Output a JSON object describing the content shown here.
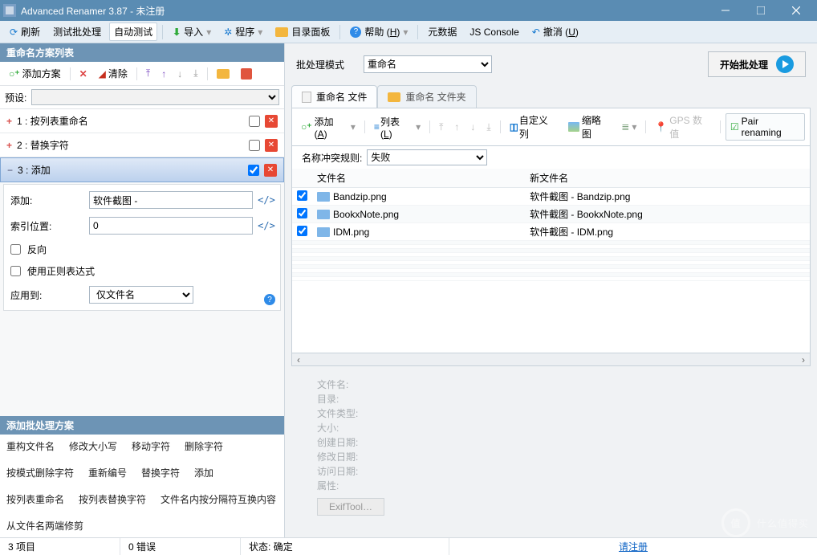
{
  "title": "Advanced Renamer 3.87 - 未注册",
  "menu": {
    "refresh": "刷新",
    "test_batch": "测试批处理",
    "auto_test": "自动测试",
    "import": "导入",
    "program": "程序",
    "folder_panel": "目录面板",
    "help": "帮助 (",
    "help_u": "H",
    "help_suffix": ")",
    "metadata": "元数据",
    "js_console": "JS Console",
    "undo": "撤消 (",
    "undo_u": "U",
    "undo_suffix": ")"
  },
  "left": {
    "header": "重命名方案列表",
    "add_method": "添加方案",
    "clear": "清除",
    "preset_label": "预设:",
    "methods": [
      {
        "idx": "1",
        "name": "按列表重命名",
        "checked": false
      },
      {
        "idx": "2",
        "name": "替换字符",
        "checked": false
      },
      {
        "idx": "3",
        "name": "添加",
        "checked": true
      }
    ],
    "add_form": {
      "add_label": "添加:",
      "add_value": "软件截图 - ",
      "index_label": "索引位置:",
      "index_value": "0",
      "backwards": "反向",
      "regex": "使用正则表达式",
      "apply_label": "应用到:",
      "apply_value": "仅文件名"
    },
    "add_scheme_header": "添加批处理方案",
    "schemes": [
      "重构文件名",
      "修改大小写",
      "移动字符",
      "删除字符",
      "按模式删除字符",
      "重新编号",
      "替换字符",
      "添加",
      "按列表重命名",
      "按列表替换字符",
      "文件名内按分隔符互换内容",
      "从文件名两端修剪"
    ]
  },
  "right": {
    "batch_mode_label": "批处理模式",
    "batch_mode_value": "重命名",
    "start_batch": "开始批处理",
    "tabs": {
      "files": "重命名 文件",
      "folders": "重命名 文件夹"
    },
    "file_tb": {
      "add": "添加 (",
      "add_u": "A",
      "list": "列表 (",
      "list_u": "L",
      "suffix": ")",
      "custom_cols": "自定义列",
      "thumbs": "缩略图",
      "gps": "GPS 数值",
      "pair": "Pair renaming"
    },
    "rule_label": "名称冲突规则:",
    "rule_value": "失败",
    "columns": {
      "c1": "文件名",
      "c2": "新文件名"
    },
    "rows": [
      {
        "name": "Bandzip.png",
        "newname": "软件截图 - Bandzip.png"
      },
      {
        "name": "BookxNote.png",
        "newname": "软件截图 - BookxNote.png"
      },
      {
        "name": "IDM.png",
        "newname": "软件截图 - IDM.png"
      }
    ],
    "details": {
      "filename": "文件名:",
      "dir": "目录:",
      "type": "文件类型:",
      "size": "大小:",
      "created": "创建日期:",
      "modified": "修改日期:",
      "accessed": "访问日期:",
      "attrs": "属性:",
      "exif": "ExifTool…"
    }
  },
  "status": {
    "items": "3 项目",
    "errors": "0 错误",
    "state_label": "状态:",
    "state_value": "确定",
    "register": "请注册"
  },
  "watermark": {
    "char": "值",
    "text": "什么值得买"
  }
}
